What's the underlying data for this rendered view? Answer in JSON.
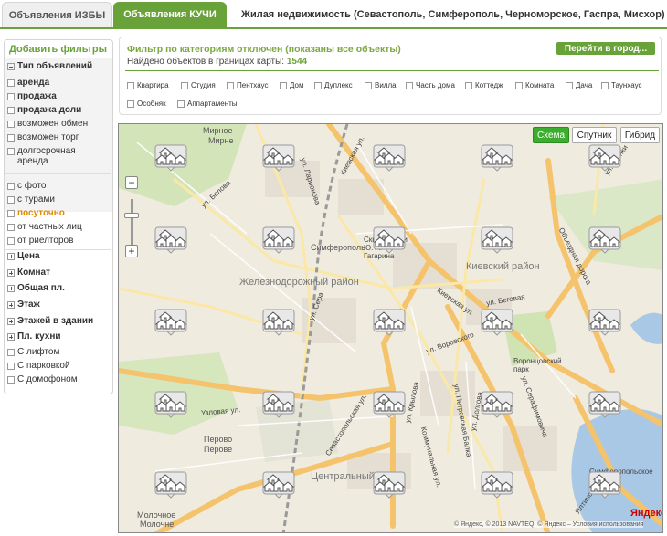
{
  "tabs": [
    {
      "label": "Объявления ИЗБЫ"
    },
    {
      "label": "Объявления КУЧИ"
    }
  ],
  "region_title": "Жилая недвижимость (Севастополь, Симферополь, Черноморское, Гаспра, Мисхор)",
  "sidebar": {
    "title": "Добавить фильтры",
    "type_header": "Тип объявлений",
    "type_items": [
      "аренда",
      "продажа",
      "продажа доли",
      "возможен обмен",
      "возможен торг",
      "долгосрочная аренда"
    ],
    "extra_items": [
      "с фото",
      "с турами",
      "посуточно",
      "от частных лиц",
      "от риелторов"
    ],
    "groups": [
      "Цена",
      "Комнат",
      "Общая пл.",
      "Этаж",
      "Этажей в здании",
      "Пл. кухни"
    ],
    "kitchen_items": [
      "С лифтом",
      "С парковкой",
      "С домофоном"
    ]
  },
  "filter": {
    "title": "Фильтр по категориям отключен (показаны все объекты)",
    "found_label": "Найдено объектов в границах карты:",
    "found_count": "1544",
    "goto_button": "Перейти в город...",
    "categories": [
      "Квартира",
      "Студия",
      "Пентхаус",
      "Дом",
      "Дуплекс",
      "Вилла",
      "Часть дома",
      "Коттедж",
      "Комната",
      "Дача",
      "Таунхаус",
      "Особняк",
      "Аппартаменты"
    ]
  },
  "map": {
    "type_buttons": [
      "Схема",
      "Спутник",
      "Гибрид"
    ],
    "zoom_in": "+",
    "zoom_out": "−",
    "districts": [
      "Железнодорожный район",
      "Киевский район",
      "Центральный"
    ],
    "places": [
      "Мирное",
      "Мирне",
      "Перово",
      "Перове",
      "Молочное",
      "Молочне",
      "Симферополь",
      "Воронцовский парк",
      "Симферопольское",
      "Сквер имени Ю. А. Гагарина"
    ],
    "streets": [
      "Киевская ул.",
      "ул. Ларионова",
      "ул. Белова",
      "ул. Глинки",
      "Объездная дорога",
      "ул. Беговая",
      "Киевская ул.",
      "ул. Севастопольская",
      "ул. Воровского",
      "ул. Крылова",
      "ул. Петровская Балка",
      "ул. Долгова",
      "ул. Серафимовича",
      "Узловая ул.",
      "Севастопольская ул.",
      "Коммунальная ул.",
      "Ялтинская ул.",
      "ул. Сера"
    ],
    "yandex_logo": "Яндекс",
    "copyright": "© Яндекс, © 2013 NAVTEQ, © Яндекс – Условия использования"
  }
}
